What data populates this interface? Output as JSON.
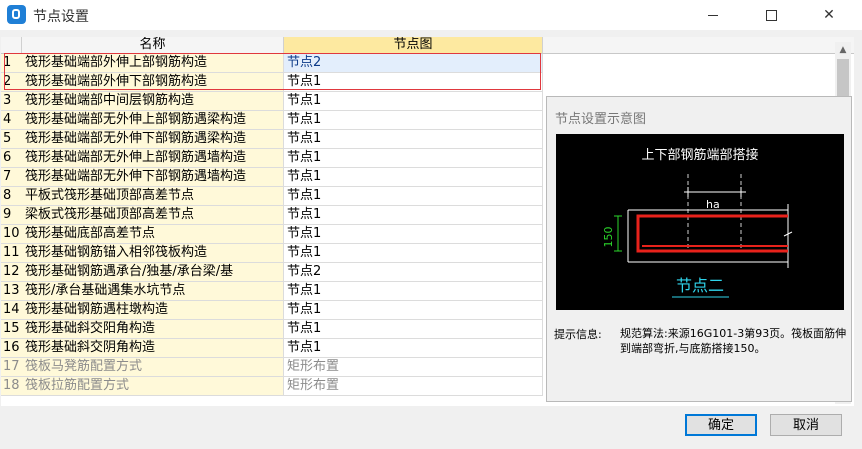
{
  "window": {
    "title": "节点设置"
  },
  "grid": {
    "headers": {
      "name": "名称",
      "node": "节点图"
    },
    "rows": [
      {
        "idx": "1",
        "name": "筏形基础端部外伸上部钢筋构造",
        "node": "节点2"
      },
      {
        "idx": "2",
        "name": "筏形基础端部外伸下部钢筋构造",
        "node": "节点1"
      },
      {
        "idx": "3",
        "name": "筏形基础端部中间层钢筋构造",
        "node": "节点1"
      },
      {
        "idx": "4",
        "name": "筏形基础端部无外伸上部钢筋遇梁构造",
        "node": "节点1"
      },
      {
        "idx": "5",
        "name": "筏形基础端部无外伸下部钢筋遇梁构造",
        "node": "节点1"
      },
      {
        "idx": "6",
        "name": "筏形基础端部无外伸上部钢筋遇墙构造",
        "node": "节点1"
      },
      {
        "idx": "7",
        "name": "筏形基础端部无外伸下部钢筋遇墙构造",
        "node": "节点1"
      },
      {
        "idx": "8",
        "name": "平板式筏形基础顶部高差节点",
        "node": "节点1"
      },
      {
        "idx": "9",
        "name": "梁板式筏形基础顶部高差节点",
        "node": "节点1"
      },
      {
        "idx": "10",
        "name": "筏形基础底部高差节点",
        "node": "节点1"
      },
      {
        "idx": "11",
        "name": "筏形基础钢筋锚入相邻筏板构造",
        "node": "节点1"
      },
      {
        "idx": "12",
        "name": "筏形基础钢筋遇承台/独基/承台梁/基",
        "node": "节点2"
      },
      {
        "idx": "13",
        "name": "筏形/承台基础遇集水坑节点",
        "node": "节点1"
      },
      {
        "idx": "14",
        "name": "筏形基础钢筋遇柱墩构造",
        "node": "节点1"
      },
      {
        "idx": "15",
        "name": "筏形基础斜交阳角构造",
        "node": "节点1"
      },
      {
        "idx": "16",
        "name": "筏形基础斜交阴角构造",
        "node": "节点1"
      },
      {
        "idx": "17",
        "name": "筏板马凳筋配置方式",
        "node": "矩形布置",
        "disabled": true
      },
      {
        "idx": "18",
        "name": "筏板拉筋配置方式",
        "node": "矩形布置",
        "disabled": true
      }
    ]
  },
  "preview": {
    "title": "节点设置示意图",
    "diagram_title": "上下部钢筋端部搭接",
    "dim_ha": "ha",
    "dim_150": "150",
    "diagram_caption": "节点二",
    "hint_label": "提示信息:",
    "hint_text": "规范算法:来源16G101-3第93页。筏板面筋伸到端部弯折,与底筋搭接150。"
  },
  "buttons": {
    "ok": "确定",
    "cancel": "取消"
  },
  "colors": {
    "header_highlight": "#fde9a0",
    "name_cell_bg": "#fff9d9",
    "selection_outline": "#e0383e",
    "rebar": "#e8221b",
    "dimension": "#2bd62b",
    "caption": "#2fd3ea",
    "primary_button_border": "#0078d7"
  }
}
